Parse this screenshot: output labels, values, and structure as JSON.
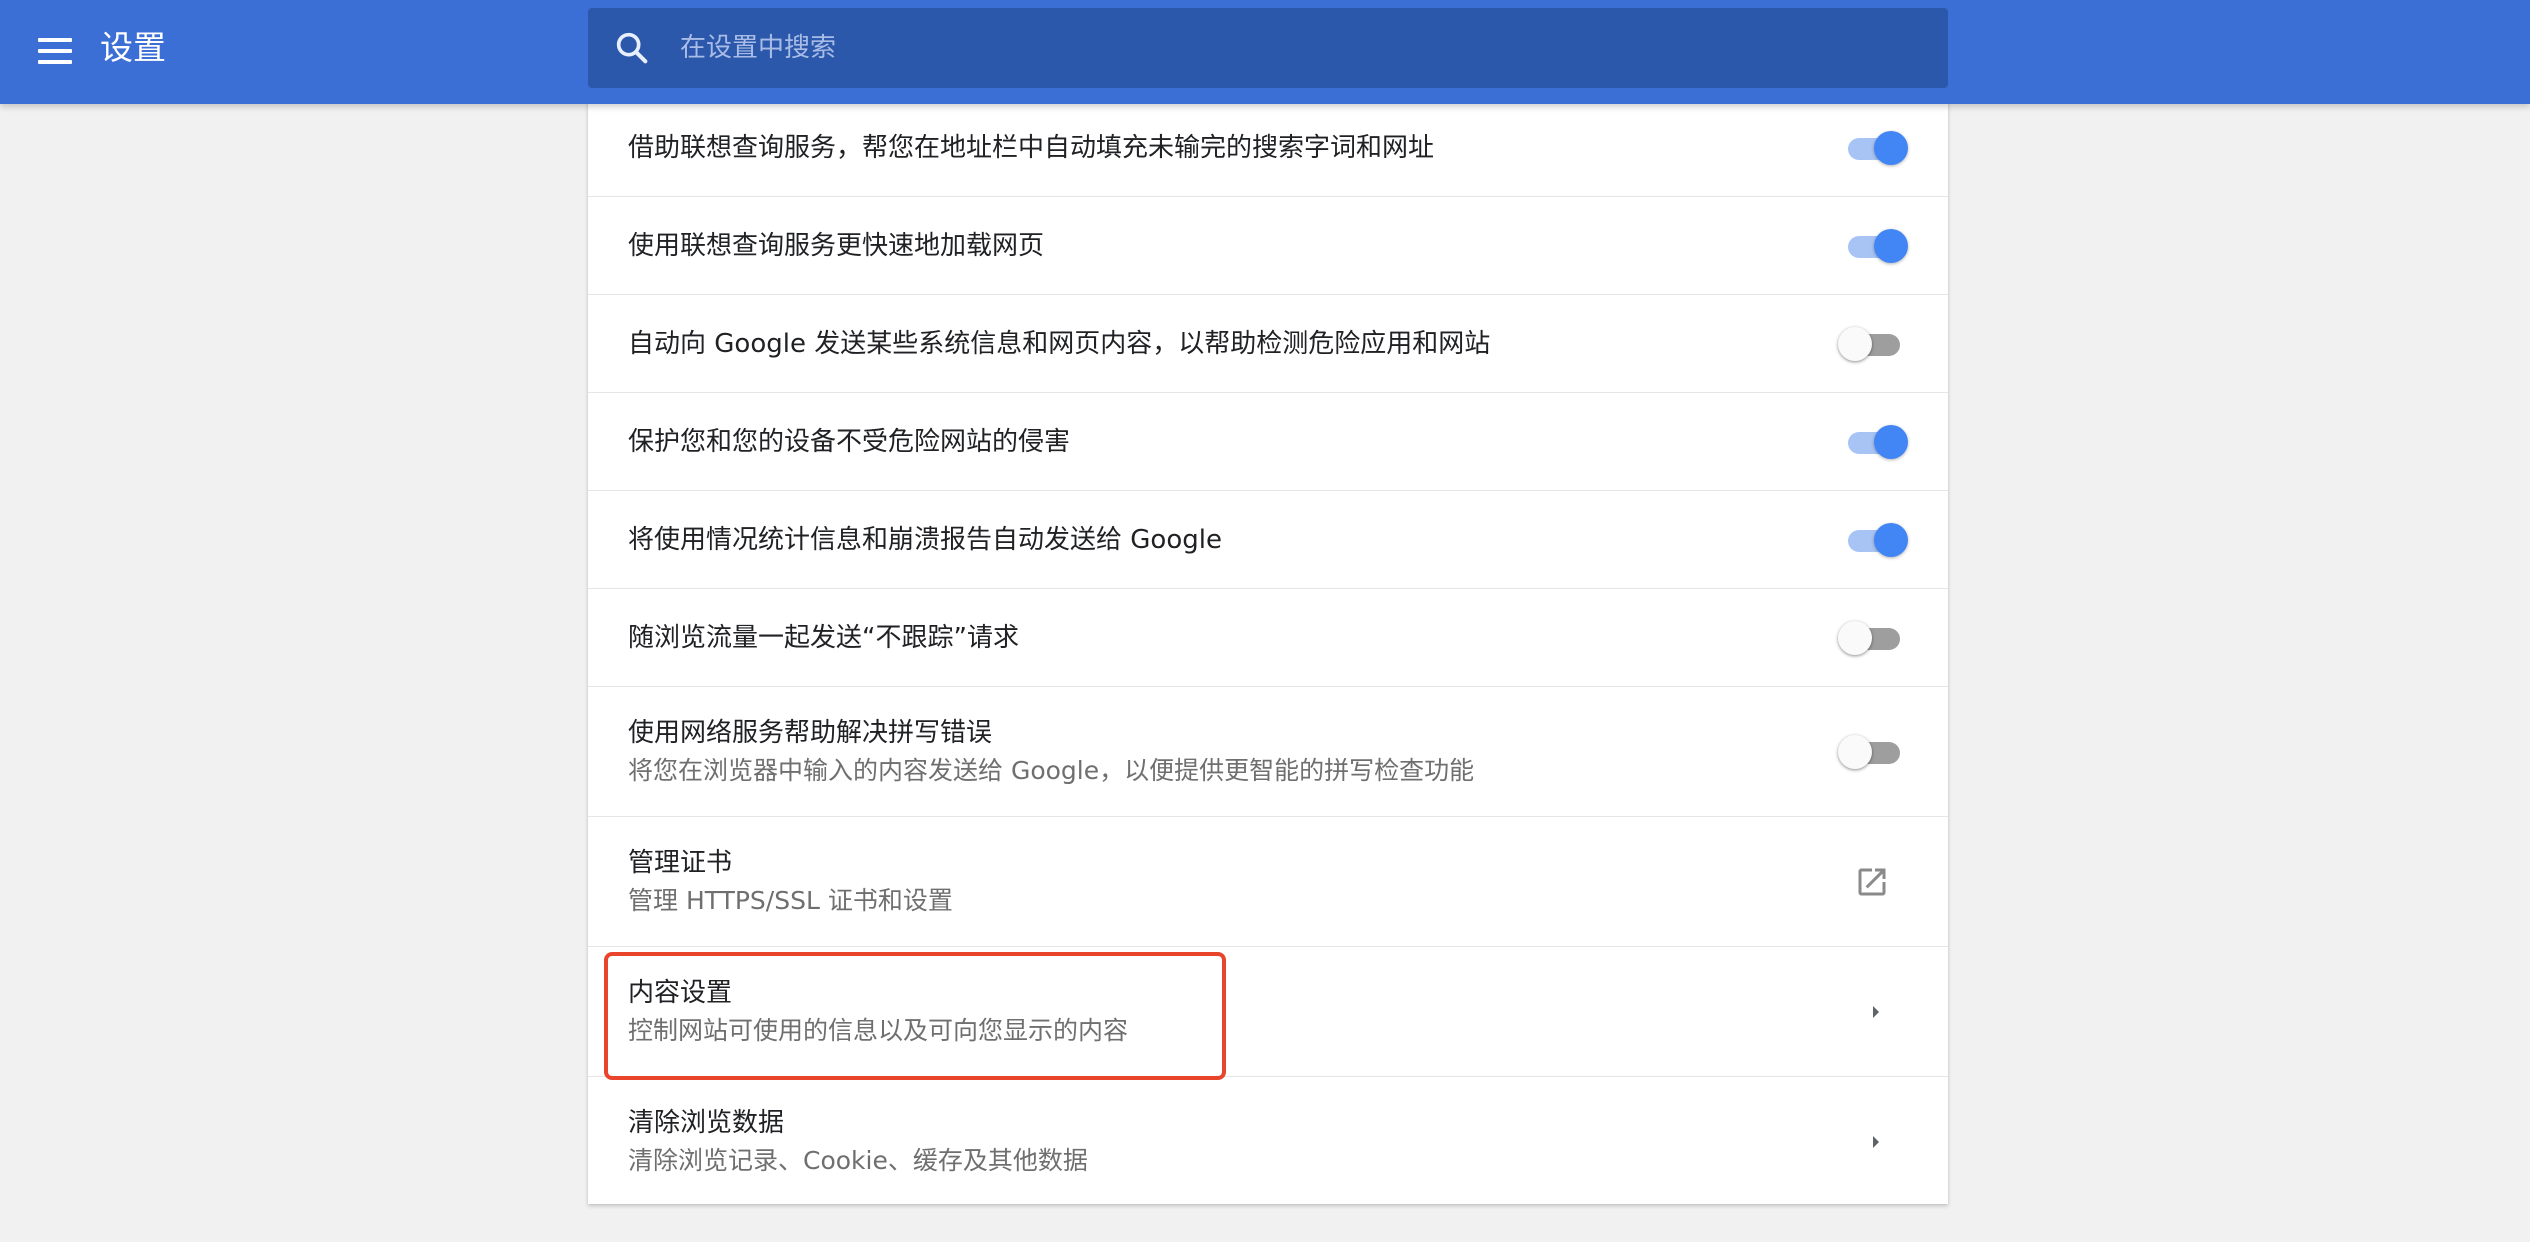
{
  "header": {
    "title": "设置",
    "search_placeholder": "在设置中搜索",
    "search_value": ""
  },
  "colors": {
    "header_bg": "#3b6fd6",
    "search_bg": "#2c58ac",
    "toggle_on": "#4285f4",
    "highlight": "#e8452c"
  },
  "settings": [
    {
      "label": "借助联想查询服务，帮您在地址栏中自动填充未输完的搜索字词和网址",
      "control": "toggle",
      "checked": true
    },
    {
      "label": "使用联想查询服务更快速地加载网页",
      "control": "toggle",
      "checked": true
    },
    {
      "label": "自动向 Google 发送某些系统信息和网页内容，以帮助检测危险应用和网站",
      "control": "toggle",
      "checked": false
    },
    {
      "label": "保护您和您的设备不受危险网站的侵害",
      "control": "toggle",
      "checked": true
    },
    {
      "label": "将使用情况统计信息和崩溃报告自动发送给 Google",
      "control": "toggle",
      "checked": true
    },
    {
      "label": "随浏览流量一起发送“不跟踪”请求",
      "control": "toggle",
      "checked": false
    },
    {
      "label": "使用网络服务帮助解决拼写错误",
      "sublabel": "将您在浏览器中输入的内容发送给 Google，以便提供更智能的拼写检查功能",
      "control": "toggle",
      "checked": false
    },
    {
      "label": "管理证书",
      "sublabel": "管理 HTTPS/SSL 证书和设置",
      "control": "external-link-icon"
    },
    {
      "label": "内容设置",
      "sublabel": "控制网站可使用的信息以及可向您显示的内容",
      "control": "arrow-right-icon",
      "highlighted": true
    },
    {
      "label": "清除浏览数据",
      "sublabel": "清除浏览记录、Cookie、缓存及其他数据",
      "control": "arrow-right-icon"
    }
  ]
}
